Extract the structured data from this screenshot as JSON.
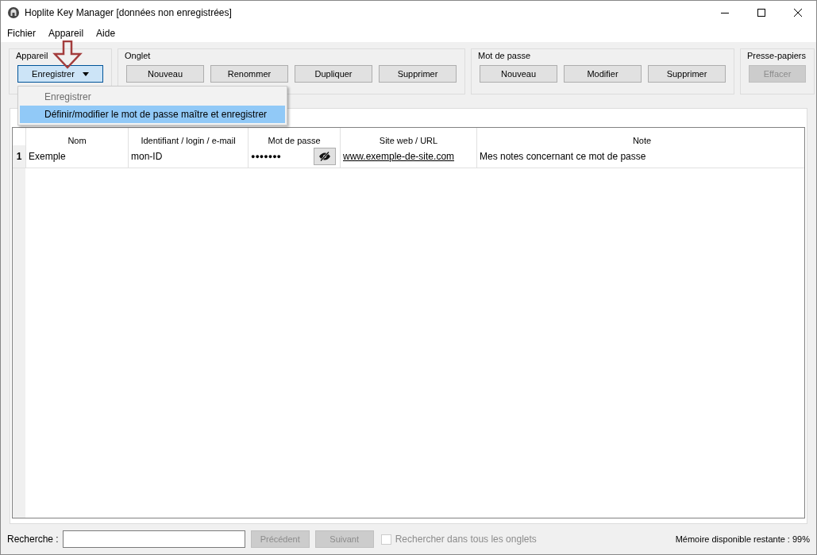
{
  "window": {
    "title": "Hoplite Key Manager [données non enregistrées]"
  },
  "menu": [
    {
      "label": "Fichier"
    },
    {
      "label": "Appareil"
    },
    {
      "label": "Aide"
    }
  ],
  "groups": [
    {
      "title": "Appareil",
      "buttons": [
        {
          "label": "Enregistrer",
          "kind": "split",
          "disabled": false
        }
      ]
    },
    {
      "title": "Onglet",
      "buttons": [
        {
          "label": "Nouveau",
          "kind": "plain",
          "disabled": false
        },
        {
          "label": "Renommer",
          "kind": "plain",
          "disabled": false
        },
        {
          "label": "Dupliquer",
          "kind": "plain",
          "disabled": false
        },
        {
          "label": "Supprimer",
          "kind": "plain",
          "disabled": false
        }
      ]
    },
    {
      "title": "Mot de passe",
      "buttons": [
        {
          "label": "Nouveau",
          "kind": "plain",
          "disabled": false
        },
        {
          "label": "Modifier",
          "kind": "plain",
          "disabled": false
        },
        {
          "label": "Supprimer",
          "kind": "plain",
          "disabled": false
        }
      ]
    },
    {
      "title": "Presse-papiers",
      "buttons": [
        {
          "label": "Effacer",
          "kind": "plain",
          "disabled": true
        }
      ]
    }
  ],
  "dropdown": {
    "items": [
      {
        "label": "Enregistrer",
        "disabled": true,
        "selected": false
      },
      {
        "label": "Définir/modifier le mot de passe maître et enregistrer",
        "disabled": false,
        "selected": true
      }
    ]
  },
  "table": {
    "columns": [
      "Nom",
      "Identifiant / login / e-mail",
      "Mot de passe",
      "Site web / URL",
      "Note"
    ],
    "rows": [
      {
        "number": "1",
        "name": "Exemple",
        "login": "mon-ID",
        "password": "●●●●●●●",
        "url": "www.exemple-de-site.com",
        "note": "Mes notes concernant ce mot de passe"
      }
    ]
  },
  "search": {
    "label": "Recherche :",
    "buttons": [
      {
        "label": "Précédent",
        "disabled": true
      },
      {
        "label": "Suivant",
        "disabled": true
      }
    ],
    "checkbox": {
      "label": "Rechercher dans tous les onglets",
      "checked": false,
      "disabled": true
    }
  },
  "memory": "Mémoire disponible restante : 99%"
}
